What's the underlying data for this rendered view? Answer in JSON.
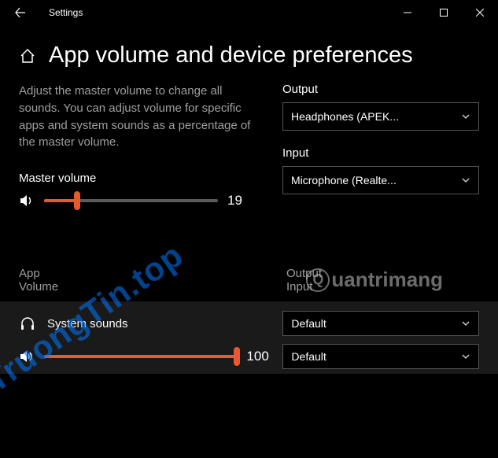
{
  "window": {
    "title": "Settings"
  },
  "page": {
    "heading": "App volume and device preferences",
    "description": "Adjust the master volume to change all sounds. You can adjust volume for specific apps and system sounds as a percentage of the master volume.",
    "master_label": "Master volume",
    "master_value": "19",
    "master_percent": 19
  },
  "devices": {
    "output_label": "Output",
    "output_value": "Headphones (APEK...",
    "input_label": "Input",
    "input_value": "Microphone (Realte..."
  },
  "columns": {
    "app_line1": "App",
    "app_line2": "Volume",
    "right_line1": "Output",
    "right_line2": "Input"
  },
  "apps": {
    "system": {
      "name": "System sounds",
      "volume": "100",
      "volume_percent": 100,
      "output": "Default",
      "input": "Default"
    }
  },
  "watermarks": {
    "w1": "TruongTin.top",
    "w2": "uantrimang"
  }
}
